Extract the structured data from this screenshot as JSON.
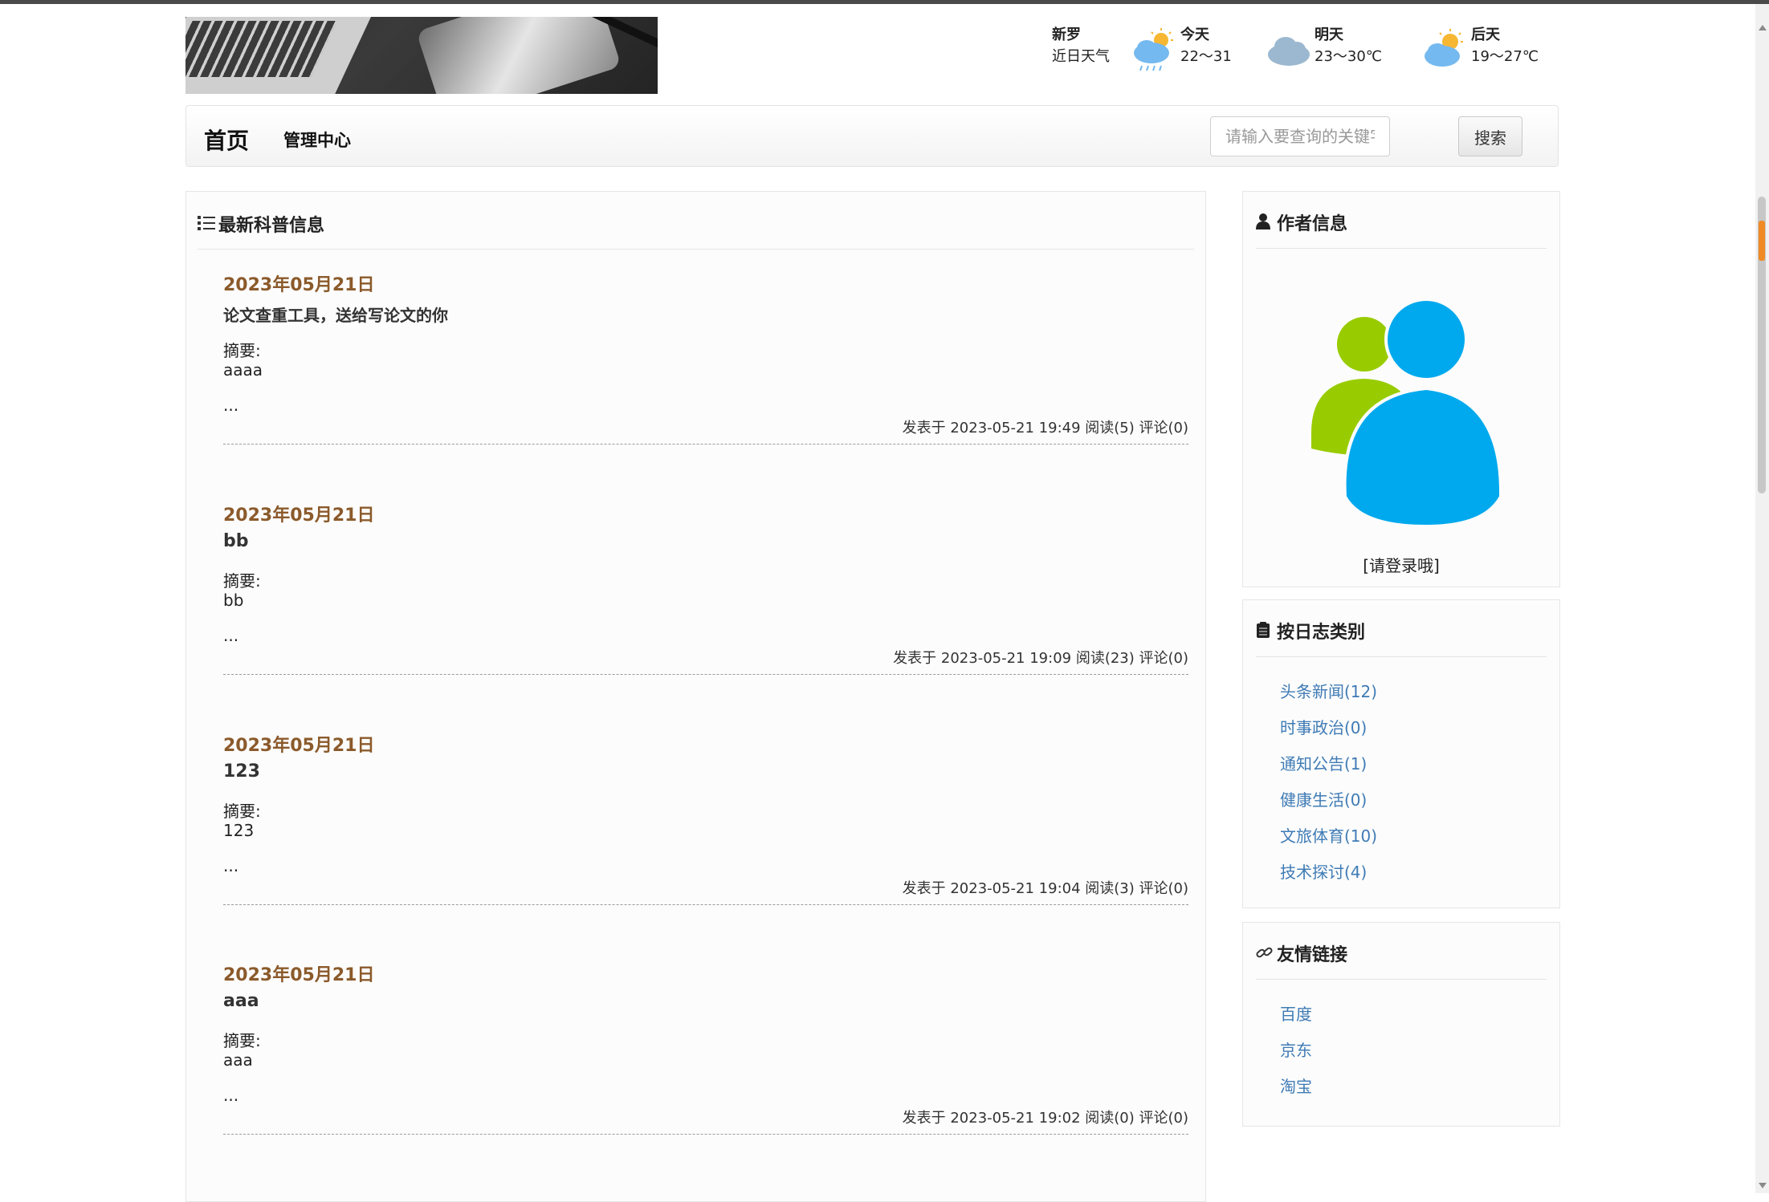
{
  "weather": {
    "city": "新罗",
    "subtitle": "近日天气",
    "days": [
      {
        "label": "今天",
        "temp": "22～31",
        "icon": "rain-sun-icon"
      },
      {
        "label": "明天",
        "temp": "23～30℃",
        "icon": "cloudy-icon"
      },
      {
        "label": "后天",
        "temp": "19～27℃",
        "icon": "partly-cloudy-icon"
      }
    ]
  },
  "nav": {
    "home": "首页",
    "admin": "管理中心",
    "search_placeholder": "请输入要查询的关键字...",
    "search_button": "搜索"
  },
  "main": {
    "title": "最新科普信息",
    "summary_label": "摘要:",
    "ellipsis": "...",
    "posts": [
      {
        "date": "2023年05月21日",
        "title": "论文查重工具，送给写论文的你",
        "summary": "aaaa",
        "meta": "发表于 2023-05-21 19:49 阅读(5) 评论(0)"
      },
      {
        "date": "2023年05月21日",
        "title": "bb",
        "summary": "bb",
        "meta": "发表于 2023-05-21 19:09 阅读(23) 评论(0)"
      },
      {
        "date": "2023年05月21日",
        "title": "123",
        "summary": "123",
        "meta": "发表于 2023-05-21 19:04 阅读(3) 评论(0)"
      },
      {
        "date": "2023年05月21日",
        "title": "aaa",
        "summary": "aaa",
        "meta": "发表于 2023-05-21 19:02 阅读(0) 评论(0)"
      }
    ]
  },
  "author": {
    "title": "作者信息",
    "login": "[请登录哦]"
  },
  "categories": {
    "title": "按日志类别",
    "items": [
      "头条新闻(12)",
      "时事政治(0)",
      "通知公告(1)",
      "健康生活(0)",
      "文旅体育(10)",
      "技术探讨(4)"
    ]
  },
  "links": {
    "title": "友情链接",
    "items": [
      "百度",
      "京东",
      "淘宝"
    ]
  },
  "colors": {
    "date": "#8b5a2b",
    "link": "#3f7bb5",
    "avatar_front": "#00a9ee",
    "avatar_back": "#99cc00"
  }
}
